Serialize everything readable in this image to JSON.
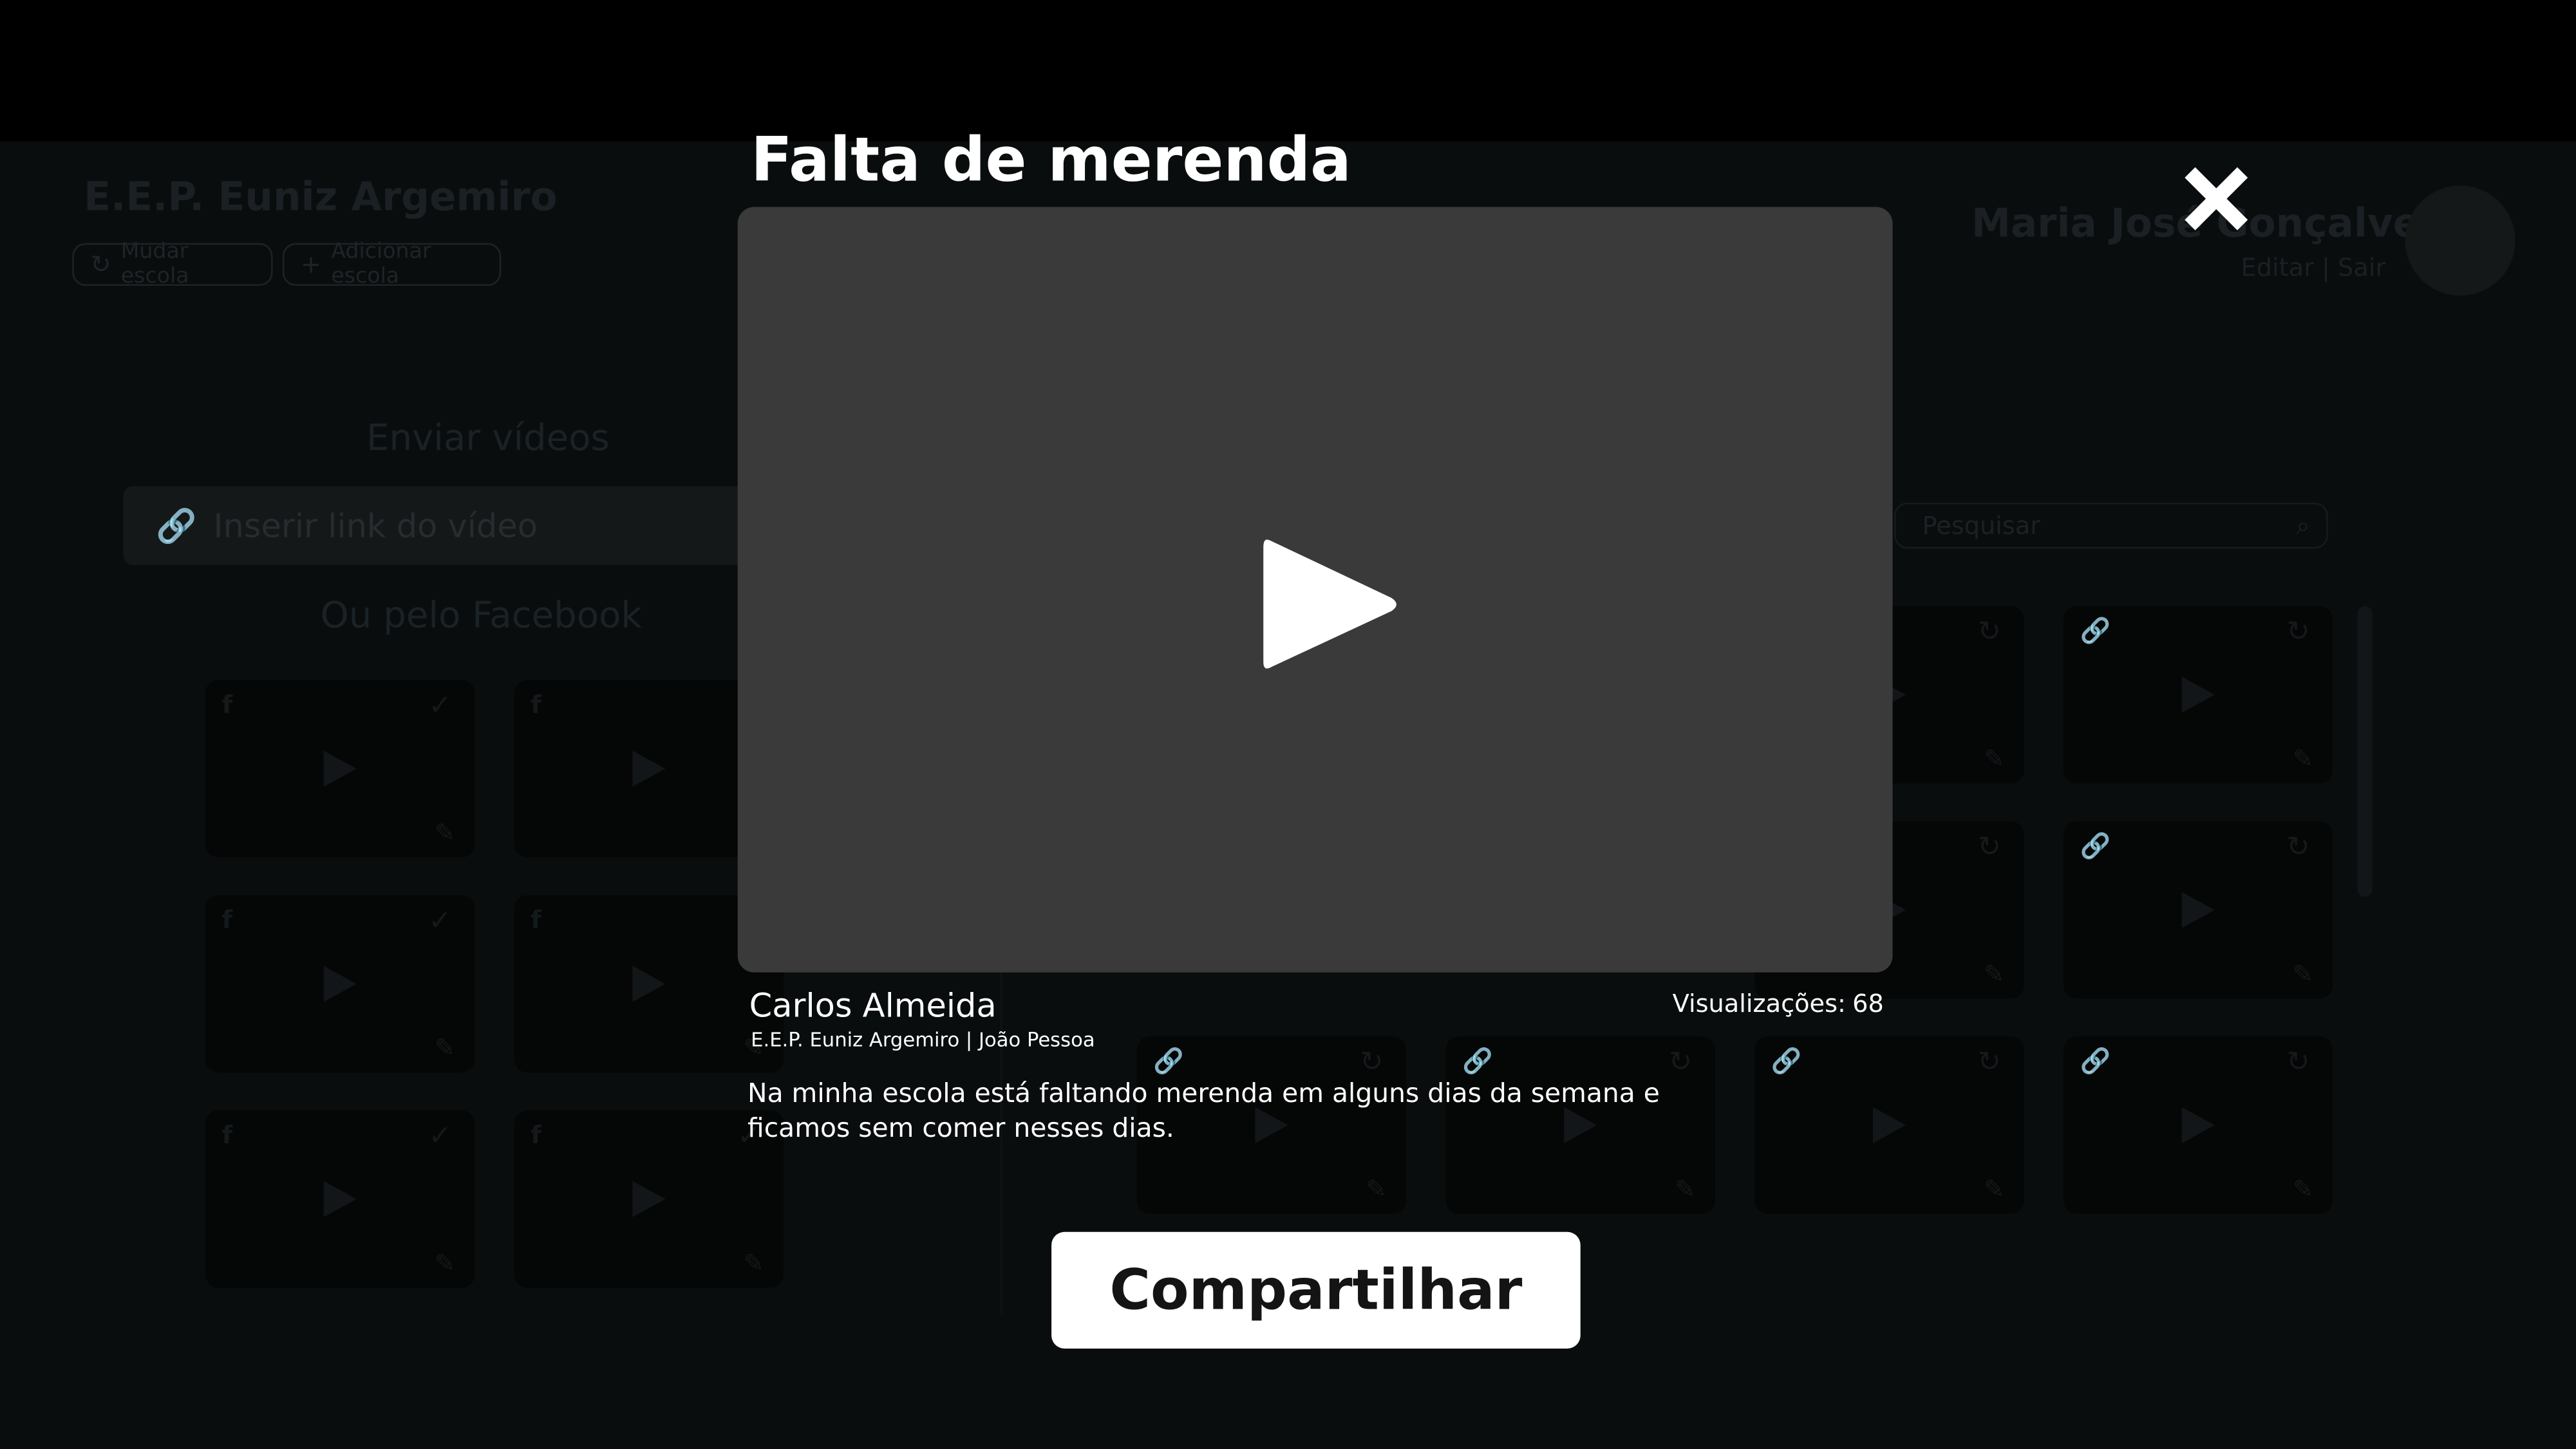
{
  "background": {
    "school": {
      "name": "E.E.P. Euniz Argemiro",
      "change_label": "Mudar escola",
      "add_label": "Adicionar escola"
    },
    "user": {
      "name": "Maria José Gonçalves",
      "links": "Editar | Sair"
    },
    "send_videos": {
      "title": "Enviar vídeos",
      "link_placeholder": "Inserir link do vídeo",
      "facebook_title": "Ou pelo Facebook"
    },
    "search": {
      "placeholder": "Pesquisar"
    }
  },
  "modal": {
    "title": "Falta de merenda",
    "author": "Carlos Almeida",
    "author_school": "E.E.P. Euniz Argemiro | João Pessoa",
    "views_label": "Visualizações:",
    "views_count": "68",
    "description": "Na minha escola está faltando merenda em alguns dias da semana e ficamos sem comer nesses dias.",
    "share_label": "Compartilhar"
  },
  "icons": {
    "close": "close-icon",
    "play": "play-icon",
    "link": "link-icon",
    "refresh": "refresh-icon",
    "plus": "plus-icon",
    "edit": "pencil-icon",
    "check": "check-icon",
    "facebook": "facebook-icon",
    "search": "search-icon"
  },
  "colors": {
    "overlay_bg": "#0a0d0e",
    "player_bg": "#3a3a3a",
    "share_button_bg": "#ffffff"
  }
}
